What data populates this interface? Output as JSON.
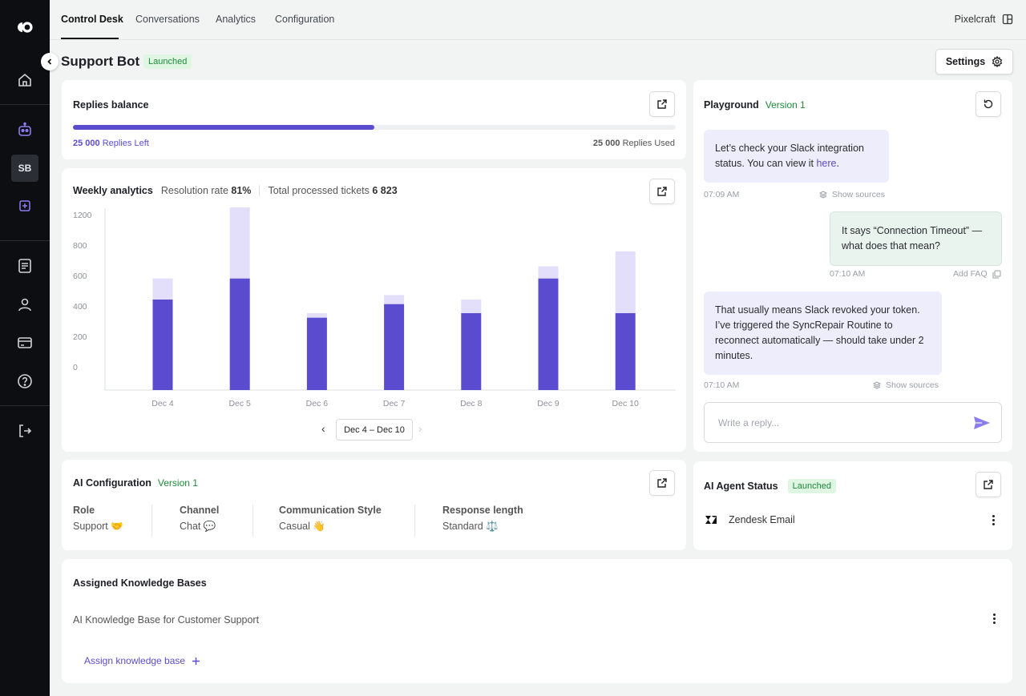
{
  "sidebar": {
    "avatar_initials": "SB"
  },
  "topnav": {
    "tabs": [
      {
        "label": "Control Desk",
        "active": true
      },
      {
        "label": "Conversations",
        "active": false
      },
      {
        "label": "Analytics",
        "active": false
      },
      {
        "label": "Configuration",
        "active": false
      }
    ],
    "workspace": "Pixelcraft"
  },
  "header": {
    "title": "Support Bot",
    "status": "Launched",
    "settings_label": "Settings"
  },
  "replies_balance": {
    "title": "Replies balance",
    "left_value": "25 000",
    "left_label": "Replies Left",
    "used_value": "25 000",
    "used_label": "Replies Used",
    "used_fraction": 0.5
  },
  "weekly_analytics": {
    "title": "Weekly analytics",
    "resolution_label": "Resolution rate",
    "resolution_value": "81%",
    "processed_label": "Total processed tickets",
    "processed_value": "6 823",
    "range": "Dec 4 – Dec 10"
  },
  "chart_data": {
    "type": "bar",
    "stacked": true,
    "categories": [
      "Dec 4",
      "Dec 5",
      "Dec 6",
      "Dec 7",
      "Dec 8",
      "Dec 9",
      "Dec 10"
    ],
    "series": [
      {
        "values": [
          600,
          740,
          480,
          570,
          510,
          740,
          510
        ]
      },
      {
        "values": [
          140,
          470,
          30,
          60,
          90,
          80,
          410
        ]
      }
    ],
    "yticks": [
      0,
      200,
      400,
      600,
      800,
      1200
    ],
    "colors": [
      "#5b4ccf",
      "#e3defa"
    ]
  },
  "playground": {
    "title": "Playground",
    "version": "Version 1",
    "messages": [
      {
        "role": "bot",
        "text": "Let’s check your Slack integration status. You can view it ",
        "link": "here",
        "after": ".",
        "time": "07:09 AM",
        "action": "Show sources"
      },
      {
        "role": "user",
        "text": "It says “Connection Timeout” — what does that mean?",
        "time": "07:10 AM",
        "action": "Add FAQ"
      },
      {
        "role": "bot",
        "text": "That usually means Slack revoked your token. I’ve triggered the SyncRepair Routine to reconnect automatically — should take under 2 minutes.",
        "time": "07:10 AM",
        "action": "Show sources"
      }
    ],
    "reply_placeholder": "Write a reply..."
  },
  "ai_config": {
    "title": "AI Configuration",
    "version": "Version 1",
    "items": [
      {
        "label": "Role",
        "value": "Support 🤝"
      },
      {
        "label": "Channel",
        "value": "Chat 💬"
      },
      {
        "label": "Communication Style",
        "value": "Casual 👋"
      },
      {
        "label": "Response length",
        "value": "Standard ⚖️"
      }
    ]
  },
  "agent_status": {
    "title": "AI Agent Status",
    "status": "Launched",
    "integration": "Zendesk Email"
  },
  "knowledge": {
    "title": "Assigned Knowledge Bases",
    "item": "AI Knowledge Base for Customer Support",
    "assign_label": "Assign knowledge base"
  }
}
